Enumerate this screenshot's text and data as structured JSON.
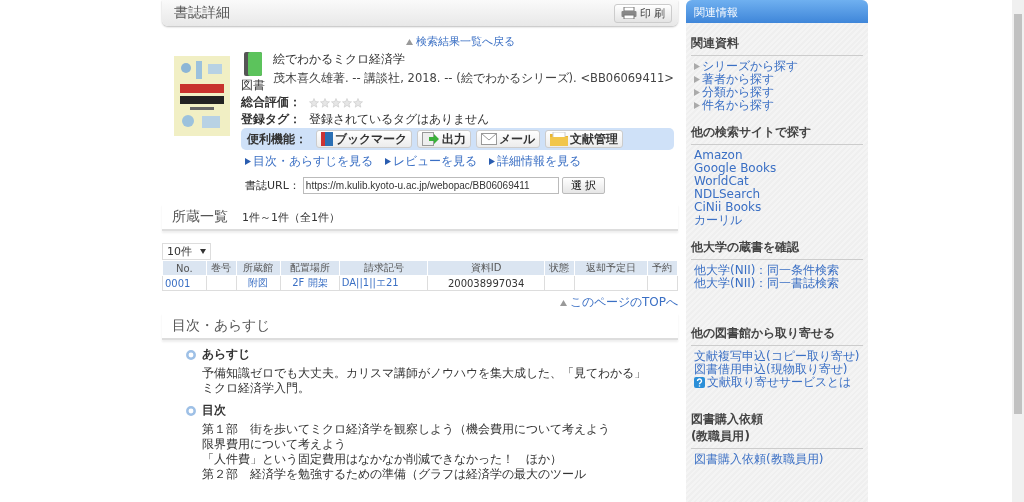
{
  "header": {
    "title": "書誌詳細",
    "print_button": "印 刷"
  },
  "back_link": "検索結果一覧へ戻る",
  "book": {
    "type_label": "図書",
    "title": "絵でわかるミクロ経済学",
    "description": "茂木喜久雄著. -- 講談社, 2018. -- (絵でわかるシリーズ). <BB06069411>",
    "rating_label": "総合評価：",
    "stars": 0,
    "tags_label": "登録タグ：",
    "tags_value": "登録されているタグはありません",
    "tools_label": "便利機能：",
    "tools": [
      {
        "kind": "bookmark",
        "label": "ブックマーク"
      },
      {
        "kind": "export",
        "label": "出力"
      },
      {
        "kind": "mail",
        "label": "メール"
      },
      {
        "kind": "folder",
        "label": "文献管理"
      }
    ],
    "links": [
      "目次・あらすじを見る",
      "レビューを見る",
      "詳細情報を見る"
    ],
    "url_label": "書誌URL：",
    "url_value": "https://m.kulib.kyoto-u.ac.jp/webopac/BB06069411",
    "select_button": "選 択"
  },
  "holdings": {
    "title": "所蔵一覧",
    "count": "1件～1件（全1件）",
    "page_size": "10件",
    "columns": [
      "No.",
      "巻号",
      "所蔵館",
      "配置場所",
      "請求記号",
      "資料ID",
      "状態",
      "返却予定日",
      "予約"
    ],
    "rows": [
      {
        "no": "0001",
        "library": "附図",
        "shelf": "2F 開架",
        "call_number": "DA||1||エ21",
        "item_id": "200038997034"
      }
    ],
    "top_link": "このページのTOPへ"
  },
  "contents": {
    "title": "目次・あらすじ",
    "sections": [
      {
        "heading": "あらすじ",
        "lines": [
          "予備知識ゼロでも大丈夫。カリスマ講師がノウハウを集大成した、「見てわかる」ミクロ経済学入門。"
        ]
      },
      {
        "heading": "目次",
        "lines": [
          "第１部　街を歩いてミクロ経済学を観察しよう（機会費用について考えよう",
          "限界費用について考えよう",
          "「人件費」という固定費用はなかなか削減できなかった！　ほか）",
          "第２部　経済学を勉強するための準備（グラフは経済学の最大のツール"
        ]
      }
    ]
  },
  "sidebar": {
    "title": "関連情報",
    "groups": [
      {
        "heading": "関連資料",
        "kind": "arrow",
        "links": [
          {
            "label": "シリーズから探す"
          },
          {
            "label": "著者から探す"
          },
          {
            "label": "分類から探す"
          },
          {
            "label": "件名から探す"
          }
        ]
      },
      {
        "heading": "他の検索サイトで探す",
        "kind": "plain",
        "links": [
          {
            "label": "Amazon"
          },
          {
            "label": "Google Books"
          },
          {
            "label": "WorldCat"
          },
          {
            "label": "NDLSearch"
          },
          {
            "label": "CiNii Books"
          },
          {
            "label": "カーリル"
          }
        ]
      },
      {
        "heading": "他大学の蔵書を確認",
        "kind": "plain",
        "links": [
          {
            "label": "他大学(NII)：同一条件検索"
          },
          {
            "label": "他大学(NII)：同一書誌検索"
          }
        ]
      },
      {
        "heading": "他の図書館から取り寄せる",
        "kind": "plain",
        "links": [
          {
            "label": "文献複写申込(コピー取り寄せ)"
          },
          {
            "label": "図書借用申込(現物取り寄せ)"
          },
          {
            "label": "文献取り寄せサービスとは",
            "help": true
          }
        ]
      },
      {
        "heading": "図書購入依頼\n(教職員用)",
        "kind": "plain",
        "links": [
          {
            "label": "図書購入依頼(教職員用)"
          }
        ]
      }
    ]
  }
}
